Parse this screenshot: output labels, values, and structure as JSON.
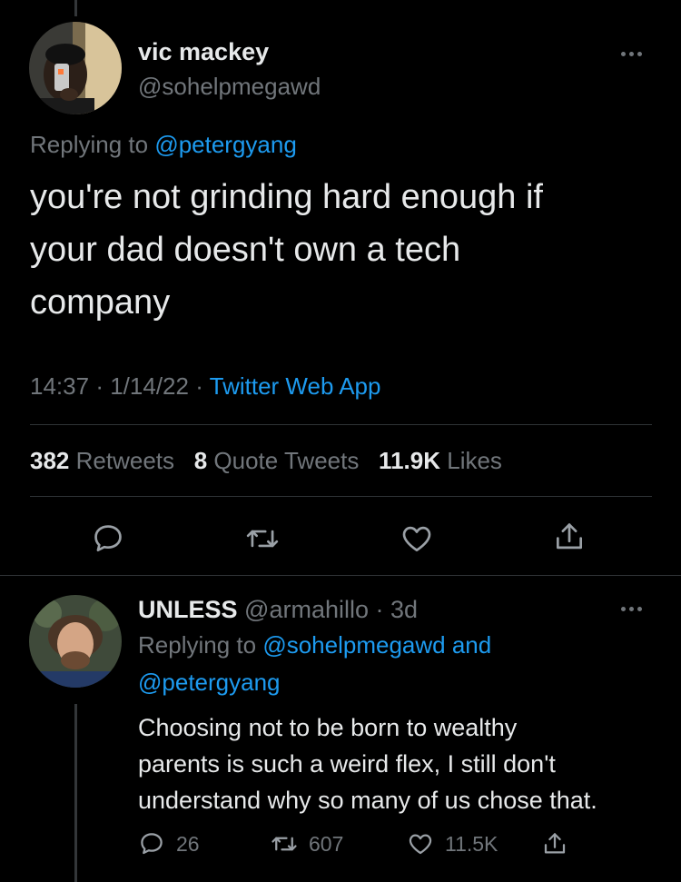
{
  "tweet": {
    "name": "vic mackey",
    "handle": "@sohelpmegawd",
    "replying_prefix": "Replying to",
    "replying_to": "@petergyang",
    "text_lines": [
      "you're not grinding hard enough if",
      "your dad doesn't own a tech",
      "company"
    ],
    "time": "14:37",
    "date": "1/14/22",
    "sep": "·",
    "source": "Twitter Web App",
    "stats": {
      "retweets_count": "382",
      "retweets_label": "Retweets",
      "quotes_count": "8",
      "quotes_label": "Quote Tweets",
      "likes_count": "11.9K",
      "likes_label": "Likes"
    }
  },
  "reply": {
    "name": "UNLESS",
    "handle": "@armahillo",
    "sep": "·",
    "age": "3d",
    "replying_prefix": "Replying to",
    "replying_to_1": "@sohelpmegawd",
    "and_label": "and",
    "replying_to_2": "@petergyang",
    "text_lines": [
      "Choosing not to be born to wealthy",
      "parents is such a weird flex, I still don't",
      "understand why so many of us chose that."
    ],
    "counts": {
      "replies": "26",
      "retweets": "607",
      "likes": "11.5K"
    }
  },
  "colors": {
    "background": "#000000",
    "text": "#e7e9ea",
    "muted": "#71767b",
    "accent": "#1d9bf0",
    "divider": "#2f3336"
  },
  "icons": [
    "reply-icon",
    "retweet-icon",
    "like-icon",
    "share-icon",
    "more-icon"
  ]
}
